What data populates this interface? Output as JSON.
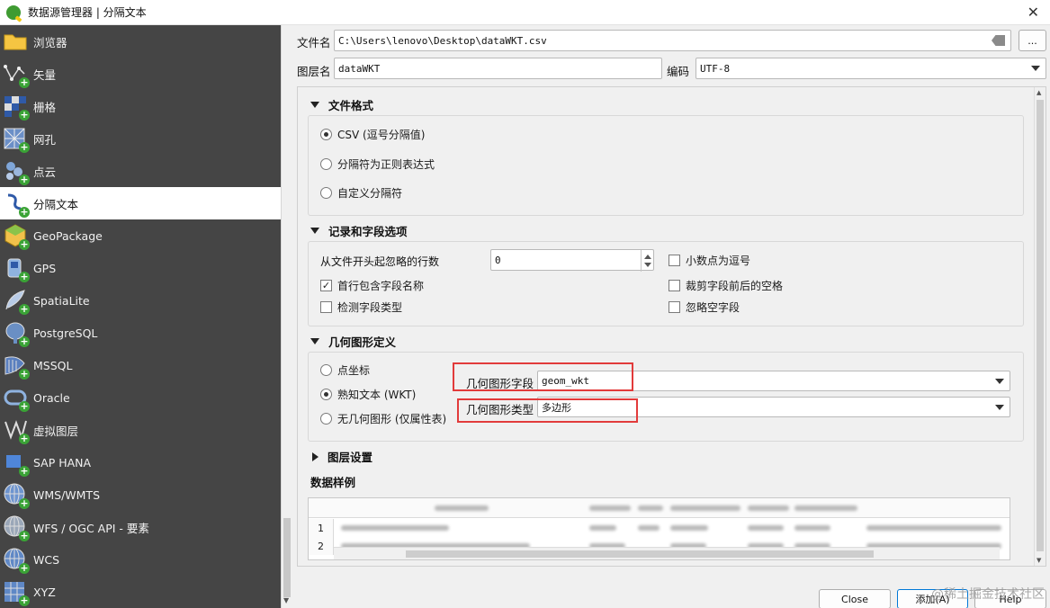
{
  "window": {
    "title": "数据源管理器 | 分隔文本"
  },
  "sidebar": {
    "items": [
      {
        "label": "浏览器"
      },
      {
        "label": "矢量"
      },
      {
        "label": "栅格"
      },
      {
        "label": "网孔"
      },
      {
        "label": "点云"
      },
      {
        "label": "分隔文本",
        "active": true
      },
      {
        "label": "GeoPackage"
      },
      {
        "label": "GPS"
      },
      {
        "label": "SpatiaLite"
      },
      {
        "label": "PostgreSQL"
      },
      {
        "label": "MSSQL"
      },
      {
        "label": "Oracle"
      },
      {
        "label": "虚拟图层"
      },
      {
        "label": "SAP HANA"
      },
      {
        "label": "WMS/WMTS"
      },
      {
        "label": "WFS / OGC API - 要素"
      },
      {
        "label": "WCS"
      },
      {
        "label": "XYZ"
      }
    ]
  },
  "file": {
    "label": "文件名",
    "value": "C:\\Users\\lenovo\\Desktop\\dataWKT.csv",
    "browse_label": "..."
  },
  "layer": {
    "label": "图层名",
    "value": "dataWKT",
    "encoding_label": "编码",
    "encoding_value": "UTF-8"
  },
  "file_format": {
    "title": "文件格式",
    "options": [
      "CSV (逗号分隔值)",
      "分隔符为正则表达式",
      "自定义分隔符"
    ],
    "selected": "CSV (逗号分隔值)"
  },
  "record_options": {
    "title": "记录和字段选项",
    "skip_lines_label": "从文件开头起忽略的行数",
    "skip_lines_value": "0",
    "first_record_has_names": {
      "label": "首行包含字段名称",
      "checked": true
    },
    "detect_field_types": {
      "label": "检测字段类型",
      "checked": false
    },
    "decimal_comma": {
      "label": "小数点为逗号",
      "checked": false
    },
    "trim_fields": {
      "label": "裁剪字段前后的空格",
      "checked": false
    },
    "discard_empty": {
      "label": "忽略空字段",
      "checked": false
    }
  },
  "geometry": {
    "title": "几何图形定义",
    "options": [
      "点坐标",
      "熟知文本 (WKT)",
      "无几何图形 (仅属性表)"
    ],
    "selected": "熟知文本 (WKT)",
    "field_label": "几何图形字段",
    "field_value": "geom_wkt",
    "type_label": "几何图形类型",
    "type_value": "多边形"
  },
  "layer_settings": {
    "title": "图层设置"
  },
  "sample": {
    "title": "数据样例",
    "row_numbers": [
      "1",
      "2"
    ]
  },
  "footer": {
    "close_label": "Close",
    "add_label": "添加(A)",
    "help_label": "Help"
  },
  "watermark": "@稀土掘金技术社区",
  "colors": {
    "sidebar_bg": "#454545",
    "highlight_red": "#e23b3b",
    "plus_green": "#3aa336"
  }
}
